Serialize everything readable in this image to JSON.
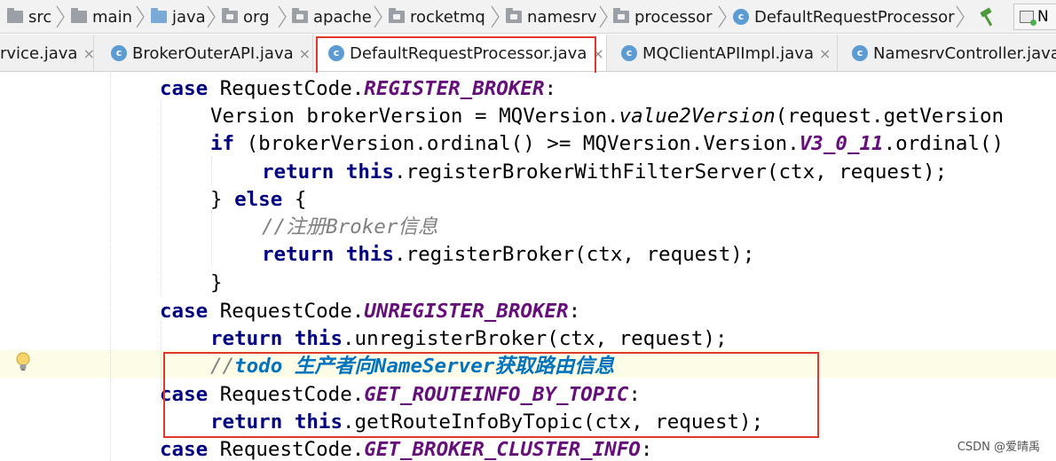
{
  "breadcrumb": {
    "items": [
      "src",
      "main",
      "java",
      "org",
      "apache",
      "rocketmq",
      "namesrv",
      "processor",
      "DefaultRequestProcessor"
    ],
    "cut_item": "N"
  },
  "tabs": [
    {
      "label": "rvice.java",
      "active": false
    },
    {
      "label": "BrokerOuterAPI.java",
      "active": false
    },
    {
      "label": "DefaultRequestProcessor.java",
      "active": true
    },
    {
      "label": "MQClientAPIImpl.java",
      "active": false
    },
    {
      "label": "NamesrvController.java",
      "active": false
    }
  ],
  "tab_close_glyph": "×",
  "tab_icon_letter": "c",
  "code": {
    "l1": {
      "kw": "case ",
      "cls": "RequestCode.",
      "const": "REGISTER_BROKER",
      "end": ":"
    },
    "l2": {
      "a": "Version brokerVersion = MQVersion.",
      "italic": "value2Version",
      "b": "(request.getVersion"
    },
    "l3": {
      "kw": "if ",
      "a": "(brokerVersion.ordinal() >= MQVersion.Version.",
      "const": "V3_0_11",
      "b": ".ordinal()"
    },
    "l4": {
      "kw": "return this",
      "a": ".registerBrokerWithFilterServer(ctx, request);"
    },
    "l5": {
      "a": "} ",
      "kw": "else",
      "b": " {"
    },
    "l6": {
      "comment": "//注册Broker信息"
    },
    "l7": {
      "kw": "return this",
      "a": ".registerBroker(ctx, request);"
    },
    "l8": {
      "a": "}"
    },
    "l9": {
      "kw": "case ",
      "cls": "RequestCode.",
      "const": "UNREGISTER_BROKER",
      "end": ":"
    },
    "l10": {
      "kw": "return this",
      "a": ".unregisterBroker(ctx, request);"
    },
    "l11": {
      "comment": "//",
      "todo": "todo 生产者向NameServer获取路由信息"
    },
    "l12": {
      "kw": "case ",
      "cls": "RequestCode.",
      "const": "GET_ROUTEINFO_BY_TOPIC",
      "end": ":"
    },
    "l13": {
      "kw": "return this",
      "a": ".getRouteInfoByTopic(ctx, request);"
    },
    "l14": {
      "kw": "case ",
      "cls": "RequestCode.",
      "const": "GET_BROKER_CLUSTER_INFO",
      "end": ":"
    }
  },
  "watermark": "CSDN @爱晴禹",
  "colors": {
    "keyword": "#000080",
    "constant": "#660e7a",
    "comment": "#808080",
    "todo": "#0073bf",
    "annotation_box": "#e0392b",
    "caret_line_bg": "#fdfce6"
  }
}
